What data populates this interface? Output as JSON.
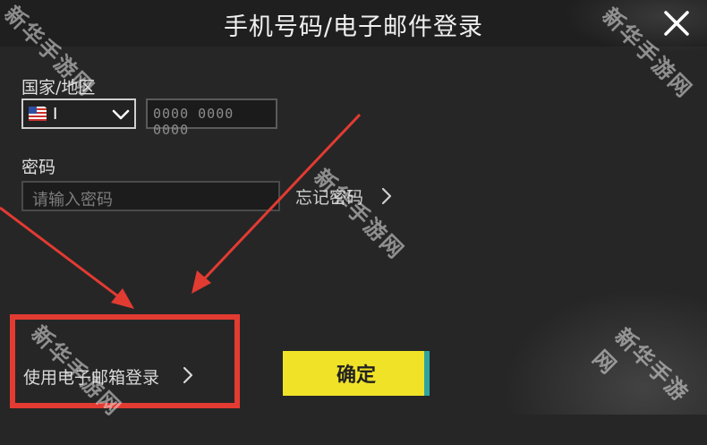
{
  "header": {
    "title": "手机号码/电子邮件登录",
    "close_icon": "close-icon"
  },
  "country": {
    "label": "国家/地区",
    "flag_icon": "us-flag-icon",
    "code": "I",
    "dropdown_icon": "chevron-down-icon"
  },
  "phone": {
    "placeholder": "0000 0000 0000"
  },
  "password": {
    "label": "密码",
    "placeholder": "请输入密码",
    "forgot_label": "忘记密码",
    "forgot_icon": "chevron-right-icon"
  },
  "footer": {
    "email_login_label": "使用电子邮箱登录",
    "email_login_icon": "chevron-right-icon",
    "confirm_label": "确定"
  },
  "watermark": {
    "text": "新华手游网"
  },
  "colors": {
    "background": "#262626",
    "header": "#1f1f1f",
    "confirm": "#f0e227",
    "annotation": "#e23b32"
  }
}
